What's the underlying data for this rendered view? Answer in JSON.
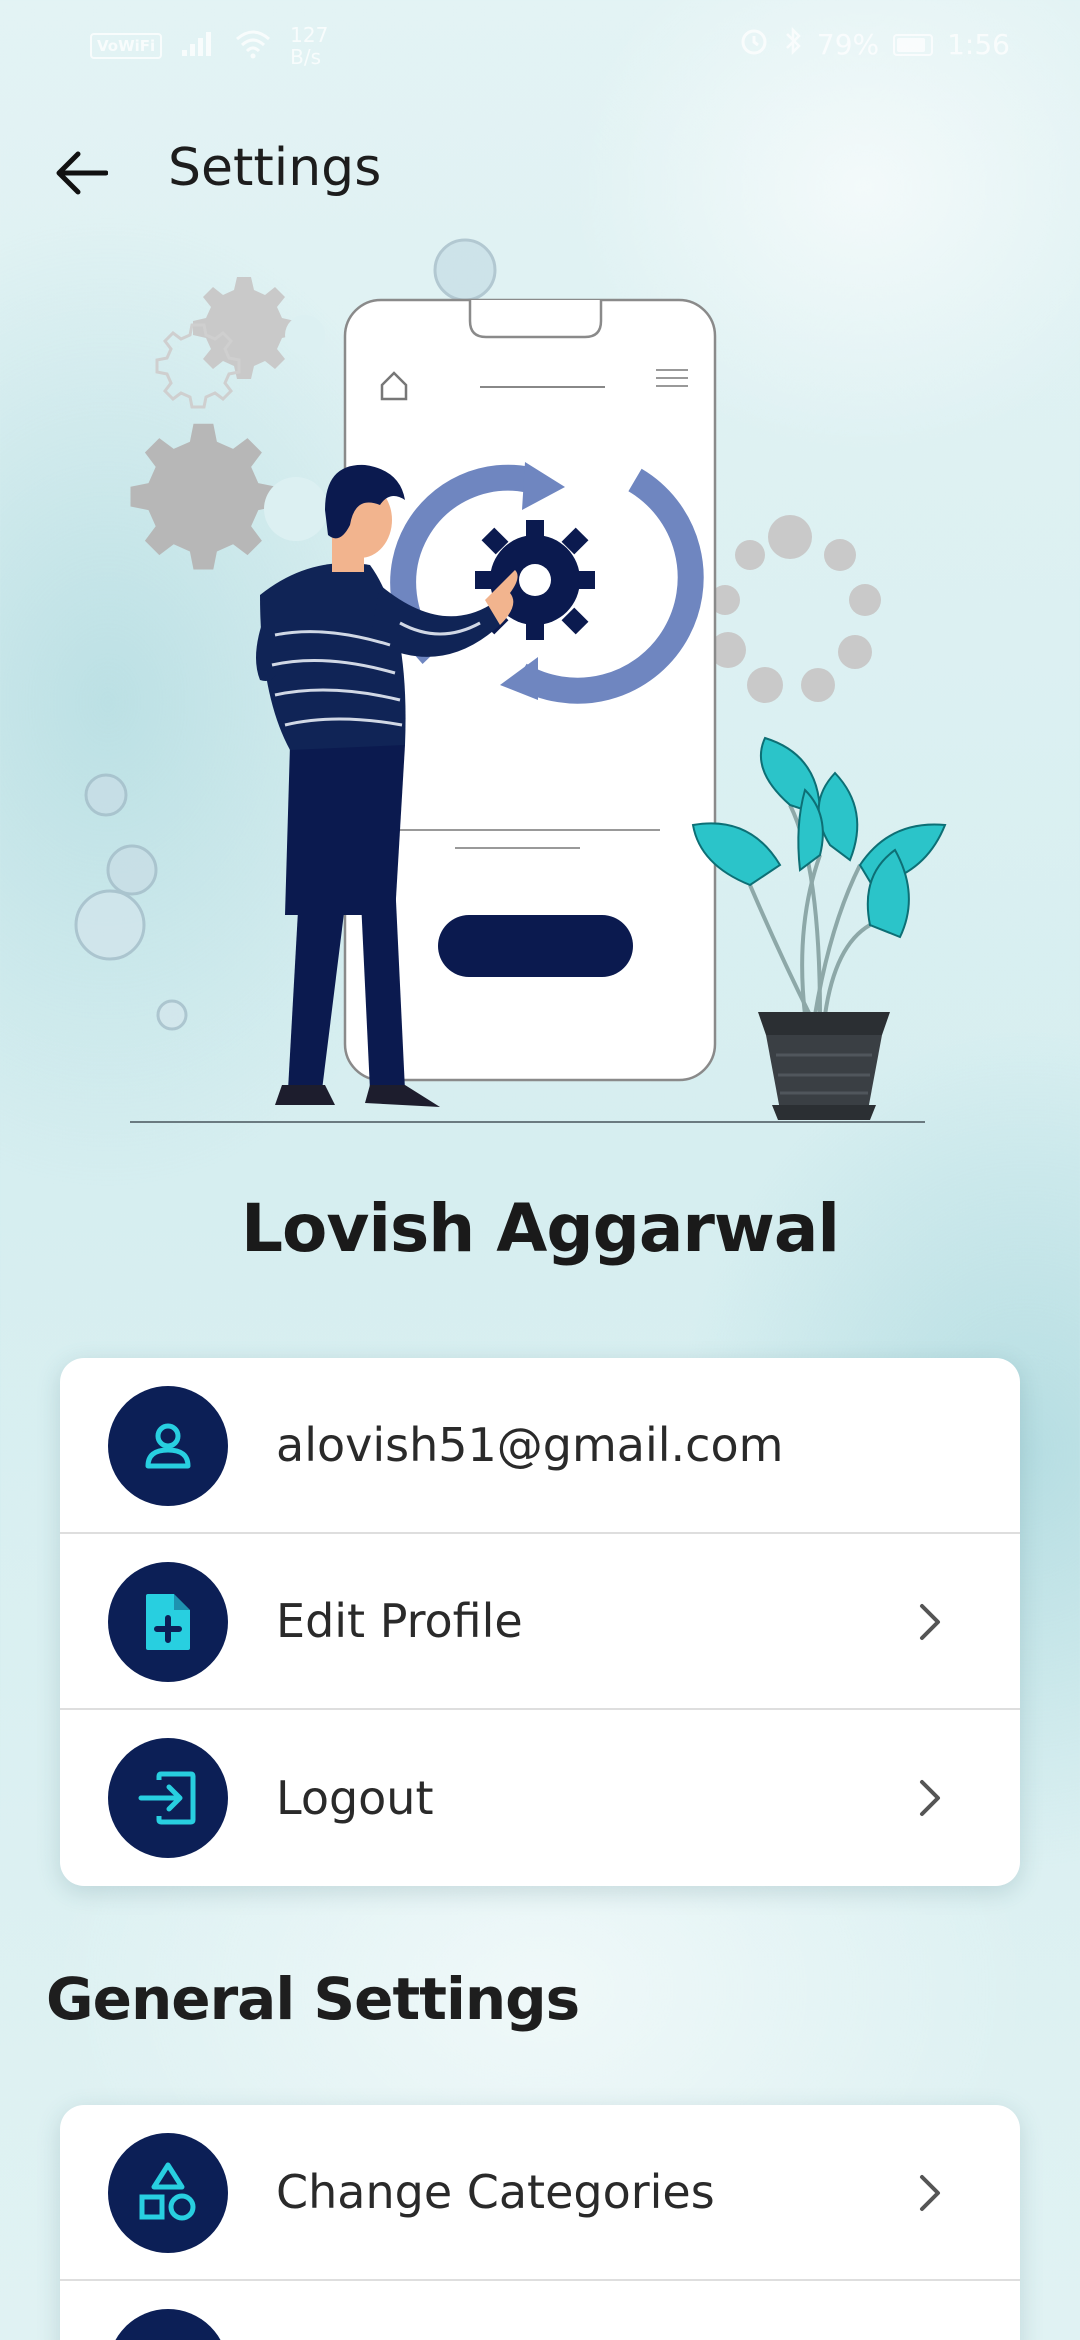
{
  "status_bar": {
    "network_label": "VoWiFi",
    "speed_value": "127",
    "speed_unit": "B/s",
    "battery_percent": "79%",
    "time": "1:56"
  },
  "header": {
    "title": "Settings"
  },
  "profile": {
    "name": "Lovish Aggarwal"
  },
  "account_card": {
    "rows": [
      {
        "label": "alovish51@gmail.com",
        "icon": "person-icon"
      },
      {
        "label": "Edit Profile",
        "icon": "file-plus-icon"
      },
      {
        "label": "Logout",
        "icon": "logout-icon"
      }
    ]
  },
  "general": {
    "title": "General Settings",
    "rows": [
      {
        "label": "Change Categories",
        "icon": "shapes-icon"
      }
    ]
  },
  "colors": {
    "icon_circle": "#0c1f56",
    "icon_glyph": "#28cfe0",
    "background": "#dcf0f2"
  }
}
